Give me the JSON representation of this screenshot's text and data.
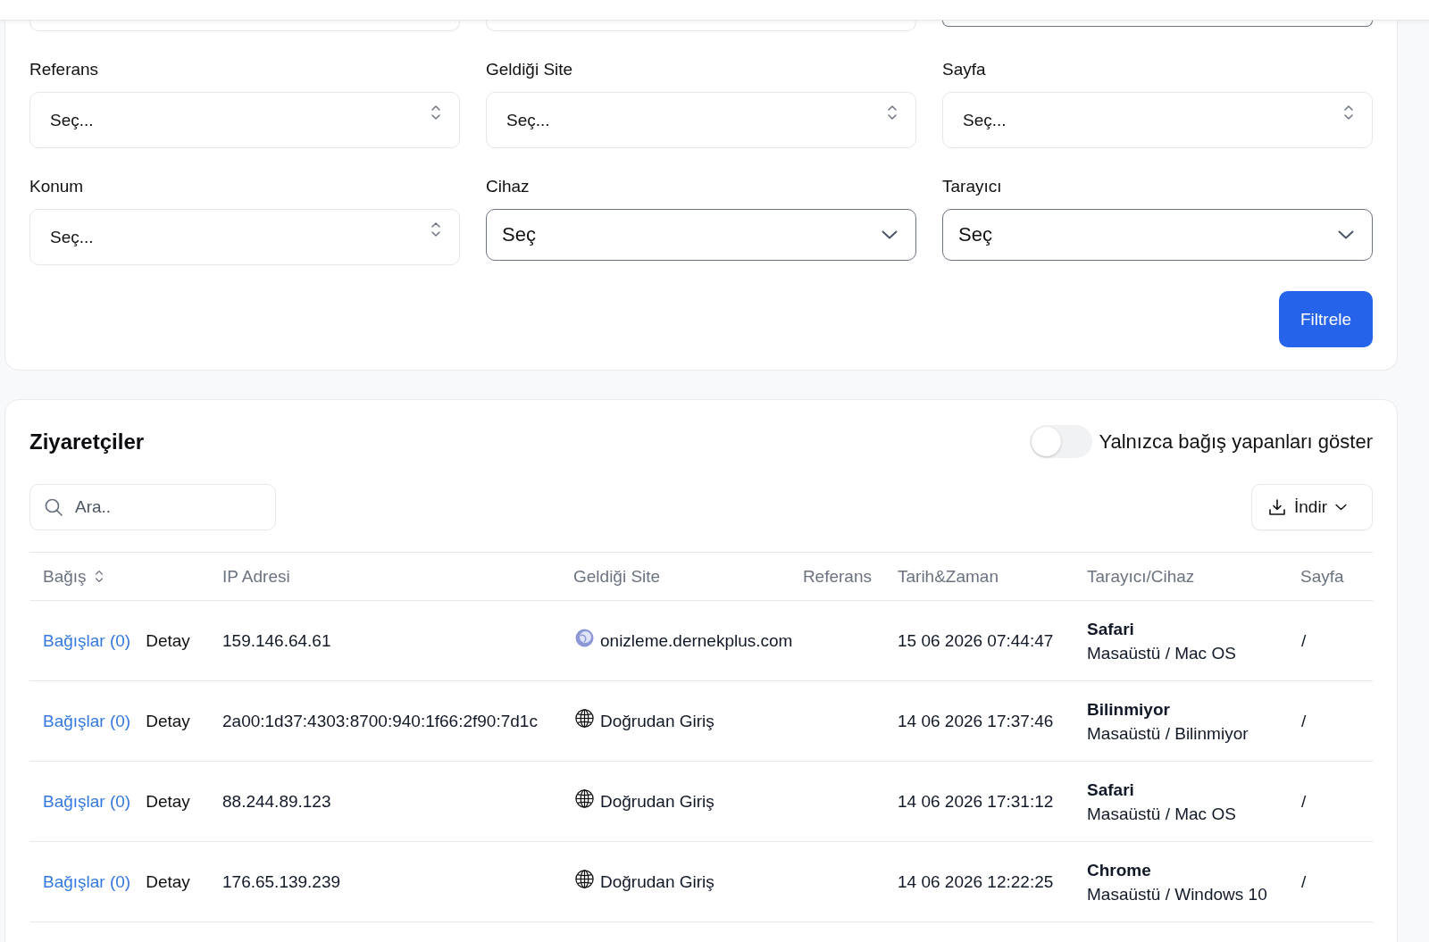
{
  "filters": {
    "hidden_row": [
      {
        "kind": "searchable"
      },
      {
        "kind": "searchable"
      },
      {
        "kind": "native"
      }
    ],
    "fields": [
      {
        "label": "Referans",
        "kind": "searchable",
        "placeholder": "Seç..."
      },
      {
        "label": "Geldiği Site",
        "kind": "searchable",
        "placeholder": "Seç..."
      },
      {
        "label": "Sayfa",
        "kind": "searchable",
        "placeholder": "Seç..."
      },
      {
        "label": "Konum",
        "kind": "searchable",
        "placeholder": "Seç..."
      },
      {
        "label": "Cihaz",
        "kind": "native",
        "value": "Seç"
      },
      {
        "label": "Tarayıcı",
        "kind": "native",
        "value": "Seç"
      }
    ],
    "submit_button": "Filtrele"
  },
  "visitors": {
    "title": "Ziyaretçiler",
    "donors_toggle": {
      "label": "Yalnızca bağış yapanları göster",
      "on": false
    },
    "search": {
      "placeholder": "Ara.."
    },
    "download_button": "İndir",
    "table": {
      "columns": [
        {
          "label": "Bağış",
          "sortable": true
        },
        {
          "label": "IP Adresi",
          "sortable": false
        },
        {
          "label": "Geldiği Site",
          "sortable": false
        },
        {
          "label": "Referans",
          "sortable": false
        },
        {
          "label": "Tarih&Zaman",
          "sortable": false
        },
        {
          "label": "Tarayıcı/Cihaz",
          "sortable": false
        },
        {
          "label": "Sayfa",
          "sortable": false
        }
      ],
      "rows": [
        {
          "donations": "Bağışlar (0)",
          "detail": "Detay",
          "ip": "159.146.64.61",
          "source": {
            "kind": "favicon",
            "text": "onizleme.dernekplus.com"
          },
          "datetime": "15 06 2026 07:44:47",
          "browser": "Safari",
          "device": "Masaüstü / Mac OS",
          "page": "/"
        },
        {
          "donations": "Bağışlar (0)",
          "detail": "Detay",
          "ip": "2a00:1d37:4303:8700:940:1f66:2f90:7d1c",
          "source": {
            "kind": "globe",
            "text": "Doğrudan Giriş"
          },
          "datetime": "14 06 2026 17:37:46",
          "browser": "Bilinmiyor",
          "device": "Masaüstü / Bilinmiyor",
          "page": "/"
        },
        {
          "donations": "Bağışlar (0)",
          "detail": "Detay",
          "ip": "88.244.89.123",
          "source": {
            "kind": "globe",
            "text": "Doğrudan Giriş"
          },
          "datetime": "14 06 2026 17:31:12",
          "browser": "Safari",
          "device": "Masaüstü / Mac OS",
          "page": "/"
        },
        {
          "donations": "Bağışlar (0)",
          "detail": "Detay",
          "ip": "176.65.139.239",
          "source": {
            "kind": "globe",
            "text": "Doğrudan Giriş"
          },
          "datetime": "14 06 2026 12:22:25",
          "browser": "Chrome",
          "device": "Masaüstü / Windows 10",
          "page": "/"
        }
      ]
    }
  }
}
